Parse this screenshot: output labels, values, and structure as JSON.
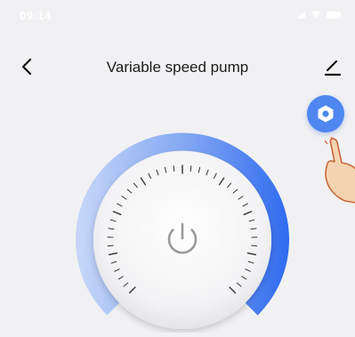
{
  "status_bar": {
    "time": "09:14",
    "icons": [
      "signal-icon",
      "wifi-icon",
      "battery-icon"
    ]
  },
  "nav": {
    "back_icon": "chevron-left-icon",
    "title": "Variable speed pump",
    "edit_icon": "pencil-icon"
  },
  "settings": {
    "icon": "hexagon-nut-icon",
    "color": "#4f86f0"
  },
  "dial": {
    "power_icon": "power-icon",
    "arc_colors": [
      "#c7d7f8",
      "#5b8def",
      "#2f6bf0"
    ],
    "tick_color": "#333333"
  }
}
